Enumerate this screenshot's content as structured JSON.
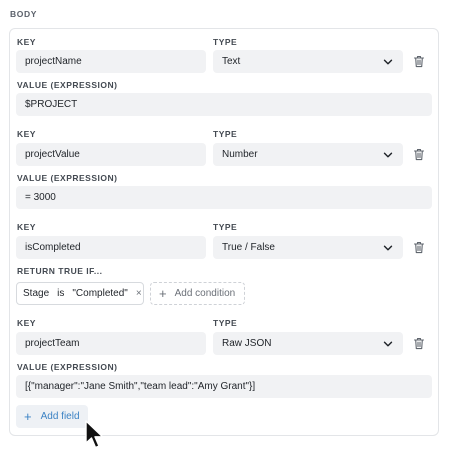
{
  "section_title": "BODY",
  "labels": {
    "key": "KEY",
    "type": "TYPE",
    "value_expression": "VALUE (EXPRESSION)",
    "return_true_if": "RETURN TRUE IF..."
  },
  "fields": [
    {
      "key": "projectName",
      "type": "Text",
      "value": "$PROJECT"
    },
    {
      "key": "projectValue",
      "type": "Number",
      "value": "= 3000"
    },
    {
      "key": "isCompleted",
      "type": "True / False"
    },
    {
      "key": "projectTeam",
      "type": "Raw JSON",
      "value": "[{\"manager\":\"Jane Smith\",\"team lead\":\"Amy Grant\"}]"
    }
  ],
  "condition": {
    "field": "Stage",
    "operator": "is",
    "value": "\"Completed\"",
    "remove_glyph": "×",
    "add_label": "Add condition"
  },
  "add_field_label": "Add field",
  "plus_glyph": "+",
  "icons": {
    "dropdown": "chevron-down-icon",
    "delete": "trash-icon",
    "pointer": "mouse-cursor-icon"
  },
  "colors": {
    "field_bg": "#f1f2f4",
    "accent": "#3b82c4"
  }
}
